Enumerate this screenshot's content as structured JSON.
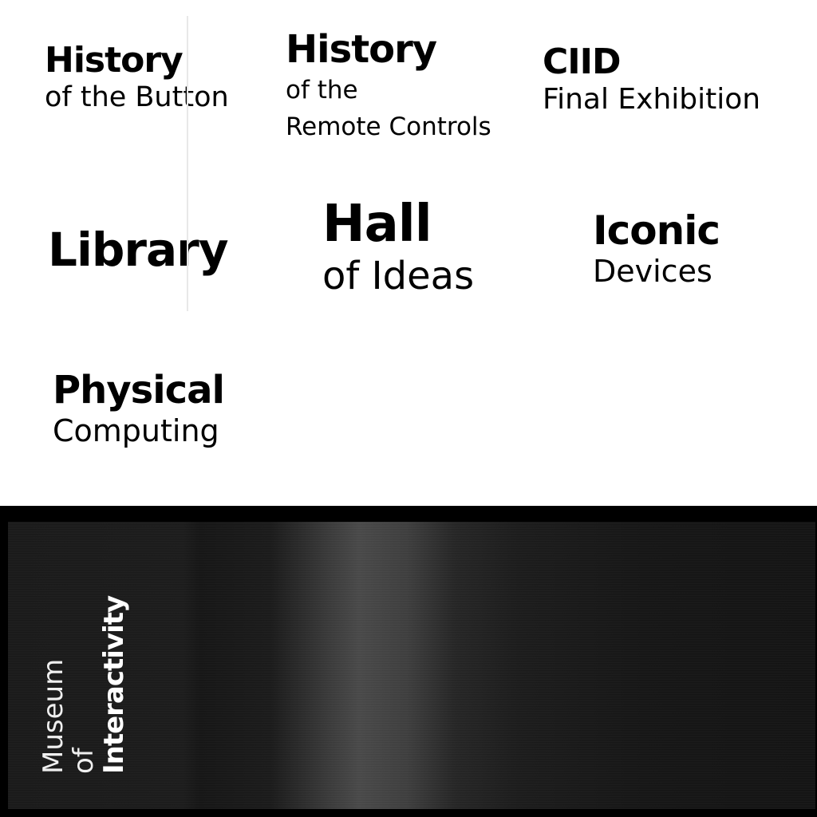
{
  "exhibits": [
    {
      "id": "history-of-the-button",
      "title": "History",
      "subtitle": "of the Button"
    },
    {
      "id": "history-of-the-remote-controls",
      "title": "History",
      "subtitle_line1": "of the",
      "subtitle_line2": "Remote Controls"
    },
    {
      "id": "ciid-final-exhibition",
      "title": "CIID",
      "subtitle": "Final Exhibition"
    },
    {
      "id": "library",
      "title": "Library"
    },
    {
      "id": "hall-of-ideas",
      "title": "Hall",
      "subtitle": "of Ideas"
    },
    {
      "id": "iconic-devices",
      "title": "Iconic",
      "subtitle": "Devices"
    },
    {
      "id": "physical-computing",
      "title": "Physical",
      "subtitle": "Computing"
    }
  ],
  "logo": {
    "line1": "Museum",
    "line2": "of",
    "line3": "Interactivity"
  },
  "colors": {
    "background": "#ffffff",
    "text": "#000000",
    "panel": "#000000",
    "logo_text": "#ffffff"
  }
}
